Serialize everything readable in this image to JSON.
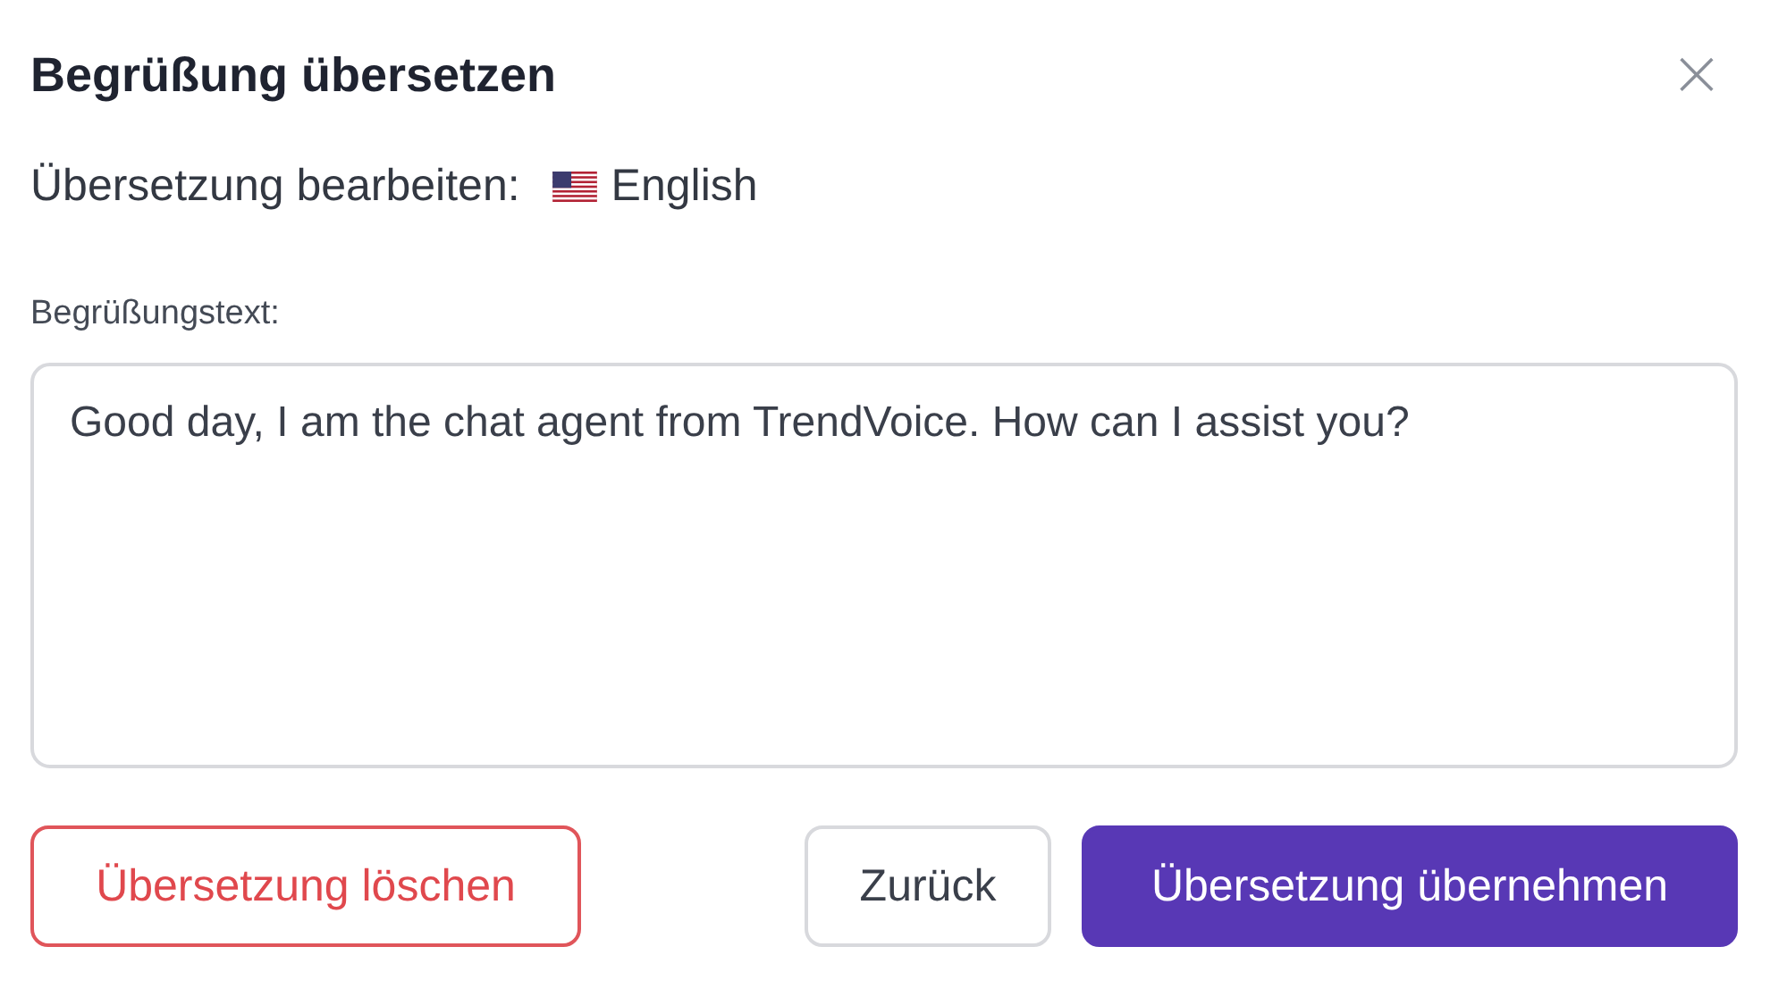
{
  "dialog": {
    "title": "Begrüßung übersetzen",
    "close": "×"
  },
  "language": {
    "label": "Übersetzung bearbeiten:",
    "name": "English"
  },
  "field": {
    "label": "Begrüßungstext:",
    "value": "Good day, I am the chat agent from TrendVoice. How can I assist you?"
  },
  "buttons": [
    {
      "label": "Übersetzung löschen",
      "kind": "danger"
    },
    {
      "label": "Zurück",
      "kind": "secondary"
    },
    {
      "label": "Übersetzung übernehmen",
      "kind": "primary"
    }
  ]
}
